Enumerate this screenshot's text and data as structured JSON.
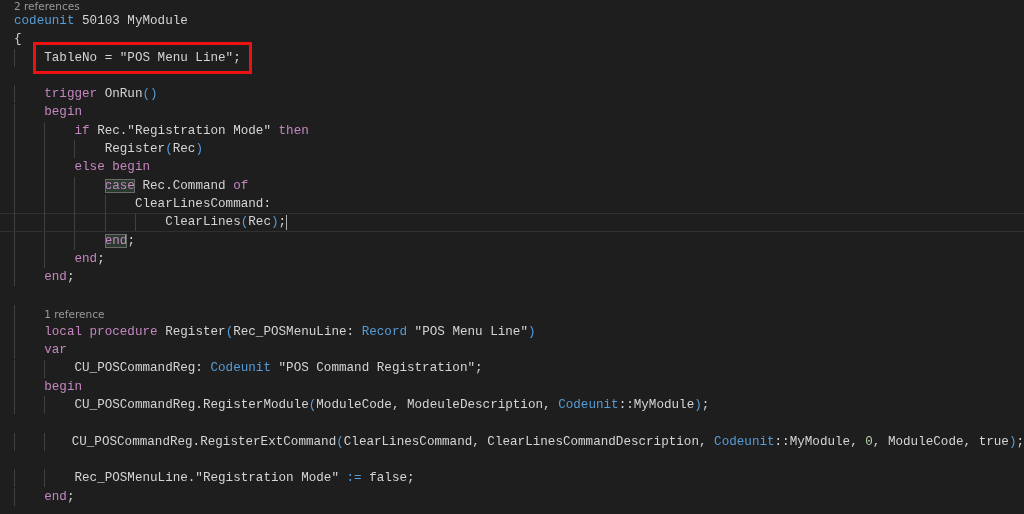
{
  "editor": {
    "lines": [
      {
        "kind": "code",
        "codelens": "2 references",
        "tokens": [
          {
            "kind": "type",
            "text": "codeunit"
          },
          {
            "kind": "plain",
            "text": " 50103 MyModule"
          }
        ]
      },
      {
        "kind": "code",
        "tokens": [
          {
            "kind": "plain",
            "text": "{"
          }
        ]
      },
      {
        "kind": "code",
        "highlighted": true,
        "tokens": [
          {
            "kind": "plain",
            "text": "    TableNo = \"POS Menu Line\";"
          }
        ]
      },
      {
        "kind": "blank"
      },
      {
        "kind": "code",
        "tokens": [
          {
            "kind": "keyword",
            "text": "    trigger"
          },
          {
            "kind": "plain",
            "text": " OnRun"
          },
          {
            "kind": "punct",
            "text": "()"
          }
        ]
      },
      {
        "kind": "code",
        "tokens": [
          {
            "kind": "keyword",
            "text": "    begin"
          }
        ]
      },
      {
        "kind": "code",
        "tokens": [
          {
            "kind": "keyword",
            "text": "        if"
          },
          {
            "kind": "plain",
            "text": " Rec.\"Registration Mode\" "
          },
          {
            "kind": "keyword",
            "text": "then"
          }
        ]
      },
      {
        "kind": "code",
        "tokens": [
          {
            "kind": "plain",
            "text": "            Register"
          },
          {
            "kind": "punct",
            "text": "("
          },
          {
            "kind": "plain",
            "text": "Rec"
          },
          {
            "kind": "punct",
            "text": ")"
          }
        ]
      },
      {
        "kind": "code",
        "tokens": [
          {
            "kind": "keyword",
            "text": "        else begin"
          }
        ]
      },
      {
        "kind": "code",
        "tokens": [
          {
            "kind": "keyword",
            "text": "            case",
            "matched": true
          },
          {
            "kind": "plain",
            "text": " Rec.Command "
          },
          {
            "kind": "keyword",
            "text": "of"
          }
        ]
      },
      {
        "kind": "code",
        "tokens": [
          {
            "kind": "plain",
            "text": "                ClearLinesCommand:"
          }
        ]
      },
      {
        "kind": "code",
        "current": true,
        "tokens": [
          {
            "kind": "plain",
            "text": "                    ClearLines"
          },
          {
            "kind": "punct",
            "text": "("
          },
          {
            "kind": "plain",
            "text": "Rec"
          },
          {
            "kind": "punct",
            "text": ")"
          },
          {
            "kind": "plain",
            "text": ";"
          }
        ]
      },
      {
        "kind": "code",
        "tokens": [
          {
            "kind": "keyword",
            "text": "            end",
            "matched": true
          },
          {
            "kind": "plain",
            "text": ";"
          }
        ]
      },
      {
        "kind": "code",
        "tokens": [
          {
            "kind": "keyword",
            "text": "        end"
          },
          {
            "kind": "plain",
            "text": ";"
          }
        ]
      },
      {
        "kind": "code",
        "tokens": [
          {
            "kind": "keyword",
            "text": "    end"
          },
          {
            "kind": "plain",
            "text": ";"
          }
        ]
      },
      {
        "kind": "blank"
      },
      {
        "kind": "code",
        "codelens": "1 reference",
        "tokens": [
          {
            "kind": "keyword",
            "text": "    local procedure"
          },
          {
            "kind": "plain",
            "text": " Register"
          },
          {
            "kind": "punct",
            "text": "("
          },
          {
            "kind": "plain",
            "text": "Rec_POSMenuLine: "
          },
          {
            "kind": "type",
            "text": "Record"
          },
          {
            "kind": "plain",
            "text": " \"POS Menu Line\""
          },
          {
            "kind": "punct",
            "text": ")"
          }
        ]
      },
      {
        "kind": "code",
        "tokens": [
          {
            "kind": "keyword",
            "text": "    var"
          }
        ]
      },
      {
        "kind": "code",
        "tokens": [
          {
            "kind": "plain",
            "text": "        CU_POSCommandReg: "
          },
          {
            "kind": "type",
            "text": "Codeunit"
          },
          {
            "kind": "plain",
            "text": " \"POS Command Registration\";"
          }
        ]
      },
      {
        "kind": "code",
        "tokens": [
          {
            "kind": "keyword",
            "text": "    begin"
          }
        ]
      },
      {
        "kind": "code",
        "tokens": [
          {
            "kind": "plain",
            "text": "        CU_POSCommandReg.RegisterModule"
          },
          {
            "kind": "punct",
            "text": "("
          },
          {
            "kind": "plain",
            "text": "ModuleCode, ModeuleDescription, "
          },
          {
            "kind": "type",
            "text": "Codeunit"
          },
          {
            "kind": "plain",
            "text": "::MyModule"
          },
          {
            "kind": "punct",
            "text": ")"
          },
          {
            "kind": "plain",
            "text": ";"
          }
        ]
      },
      {
        "kind": "blank"
      },
      {
        "kind": "code",
        "tokens": [
          {
            "kind": "plain",
            "text": "        CU_POSCommandReg.RegisterExtCommand"
          },
          {
            "kind": "punct",
            "text": "("
          },
          {
            "kind": "plain",
            "text": "ClearLinesCommand, ClearLinesCommandDescription, "
          },
          {
            "kind": "type",
            "text": "Codeunit"
          },
          {
            "kind": "plain",
            "text": "::MyModule, "
          },
          {
            "kind": "number",
            "text": "0"
          },
          {
            "kind": "plain",
            "text": ", ModuleCode, true"
          },
          {
            "kind": "punct",
            "text": ")"
          },
          {
            "kind": "plain",
            "text": ";"
          }
        ]
      },
      {
        "kind": "blank"
      },
      {
        "kind": "code",
        "tokens": [
          {
            "kind": "plain",
            "text": "        Rec_POSMenuLine.\"Registration Mode\" "
          },
          {
            "kind": "punct",
            "text": ":="
          },
          {
            "kind": "plain",
            "text": " false;"
          }
        ]
      },
      {
        "kind": "code",
        "tokens": [
          {
            "kind": "keyword",
            "text": "    end"
          },
          {
            "kind": "plain",
            "text": ";"
          }
        ]
      }
    ]
  }
}
